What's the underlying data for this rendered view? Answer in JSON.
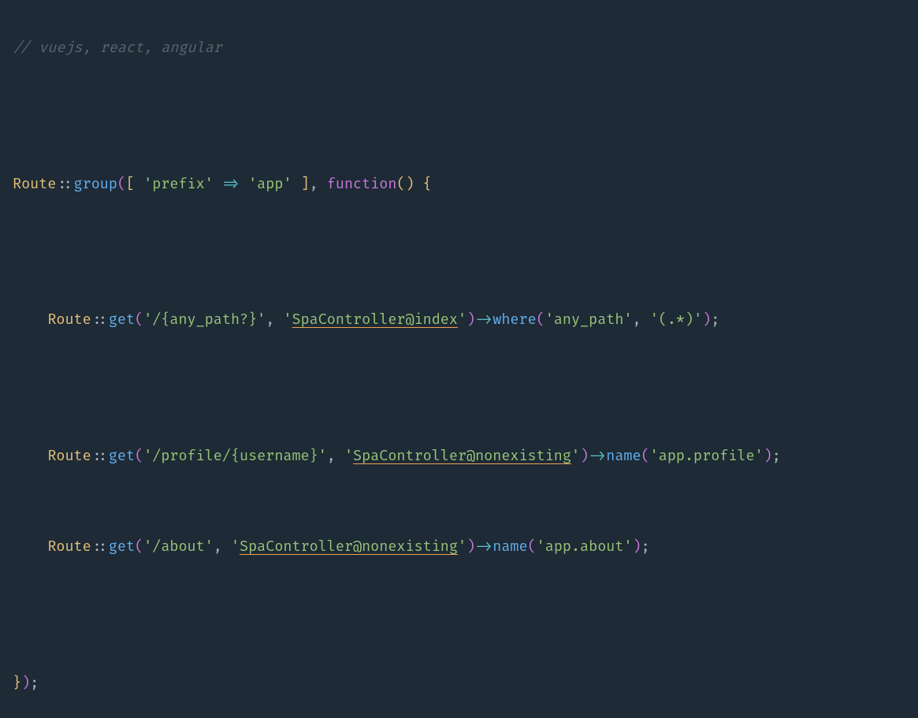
{
  "comment": "// vuejs, react, angular",
  "line1": {
    "class": "Route",
    "scope": "::",
    "method": "group",
    "paren_open": "(",
    "bracket_open": "[ ",
    "key": "'prefix'",
    "arrow": " => ",
    "value": "'app'",
    "bracket_close": " ]",
    "comma": ", ",
    "keyword": "function",
    "fn_parens": "()",
    "brace_open": " {"
  },
  "route1": {
    "class": "Route",
    "scope": "::",
    "method": "get",
    "paren_open": "(",
    "arg1": "'/{any_path?}'",
    "comma1": ", ",
    "arg2_q": "'",
    "arg2_text": "SpaController@index",
    "arg2_q2": "'",
    "paren_close": ")",
    "arrow": "->",
    "method2": "where",
    "paren2_open": "(",
    "arg3": "'any_path'",
    "comma2": ", ",
    "arg4": "'(.*)'",
    "paren2_close": ")",
    "semi": ";"
  },
  "route2": {
    "class": "Route",
    "scope": "::",
    "method": "get",
    "paren_open": "(",
    "arg1": "'/profile/{username}'",
    "comma1": ", ",
    "arg2_q": "'",
    "arg2_text": "SpaController@nonexisting",
    "arg2_q2": "'",
    "paren_close": ")",
    "arrow": "->",
    "method2": "name",
    "paren2_open": "(",
    "arg3": "'app.profile'",
    "paren2_close": ")",
    "semi": ";"
  },
  "route3": {
    "class": "Route",
    "scope": "::",
    "method": "get",
    "paren_open": "(",
    "arg1": "'/about'",
    "comma1": ", ",
    "arg2_q": "'",
    "arg2_text": "SpaController@nonexisting",
    "arg2_q2": "'",
    "paren_close": ")",
    "arrow": "->",
    "method2": "name",
    "paren2_open": "(",
    "arg3": "'app.about'",
    "paren2_close": ")",
    "semi": ";"
  },
  "closing": {
    "brace": "}",
    "paren": ")",
    "semi": ";"
  }
}
